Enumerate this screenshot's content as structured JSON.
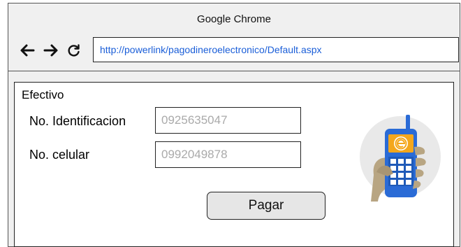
{
  "browser": {
    "title": "Google Chrome",
    "url": "http://powerlink/pagodineroelectronico/Default.aspx",
    "icons": [
      "back-arrow-icon",
      "forward-arrow-icon",
      "reload-icon"
    ]
  },
  "form": {
    "section_title": "Efectivo",
    "identification_label": "No. Identificacion",
    "identification_value": "0925635047",
    "phone_label": "No. celular",
    "phone_value": "0992049878",
    "pay_label": "Pagar"
  },
  "illustration": {
    "icon": "mobile-payment-phone-icon"
  },
  "colors": {
    "url_text": "#1a5ed8",
    "phone_body": "#2a6bd6",
    "hand": "#b8a582",
    "e_logo": "#f4a71c"
  }
}
